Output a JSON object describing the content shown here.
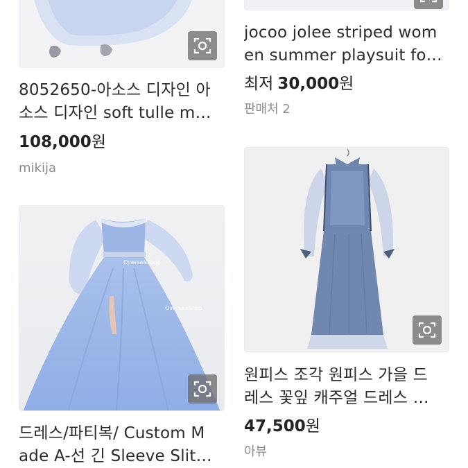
{
  "products": [
    {
      "title_line1": "8052650-아소스 디자인 아",
      "title_line2": "소스 디자인 soft tulle m…",
      "price": "108,000",
      "currency": "원",
      "seller": "mikija",
      "image_icon": "visual-search-icon"
    },
    {
      "title_line1": "jocoo jolee striped wom",
      "title_line2": "en summer playsuit fo…",
      "price_prefix": "최저",
      "price": "30,000",
      "currency": "원",
      "seller": "판매처 2",
      "image_icon": "visual-search-icon"
    },
    {
      "title_line1": "드레스/파티복/ Custom M",
      "title_line2": "ade A-선 긴 Sleeve Slit…",
      "image_watermark_1": "OverseaShop",
      "image_watermark_2": "OverseaShop",
      "image_icon": "visual-search-icon"
    },
    {
      "title_line1": "원피스 조각 원피스 가을 드",
      "title_line2": "레스 꽃잎 캐주얼 드레스 …",
      "price": "47,500",
      "currency": "원",
      "seller": "아뷰",
      "image_icon": "visual-search-icon"
    }
  ],
  "colors": {
    "dress_blue": "#9fb8e6",
    "dress_dark": "#5f7aa6",
    "seller_gray": "#8c8c8c"
  }
}
